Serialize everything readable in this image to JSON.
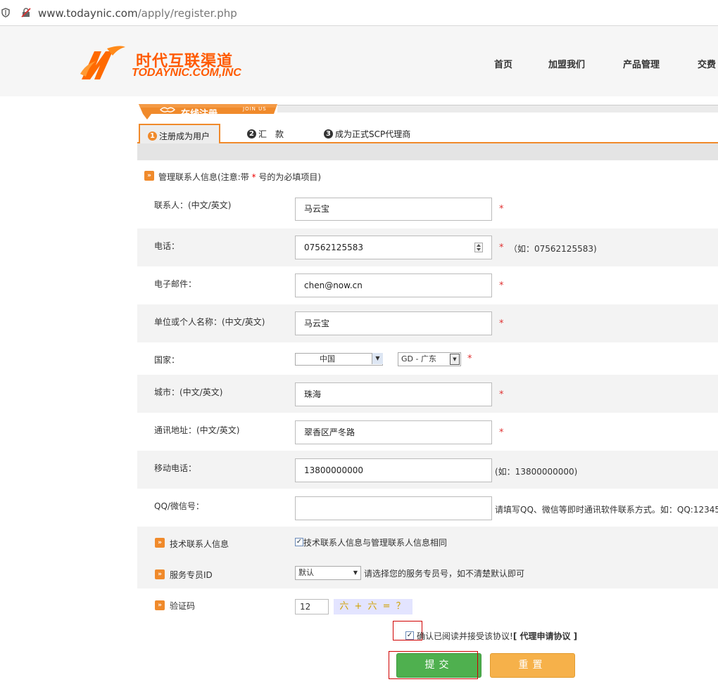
{
  "address_bar": {
    "url_main": "www.todaynic.com",
    "url_path": "/apply/register.php"
  },
  "header": {
    "logo_cn": "时代互联渠道",
    "logo_en": "TODAYNIC.COM,INC",
    "nav": [
      "首页",
      "加盟我们",
      "产品管理",
      "交费"
    ]
  },
  "title_tab": {
    "label": "在线注册",
    "sub": "JOIN US"
  },
  "steps": [
    {
      "num": "1",
      "label": "注册成为用户"
    },
    {
      "num": "2",
      "label": "汇　款"
    },
    {
      "num": "3",
      "label": "成为正式SCP代理商"
    }
  ],
  "section": {
    "text_before": "管理联系人信息(注意:带",
    "star": "*",
    "text_after": "号的为必填项目)"
  },
  "fields": {
    "contact": {
      "label": "联系人：(中文/英文)",
      "value": "马云宝",
      "star": "*"
    },
    "phone": {
      "label": "电话：",
      "value": "07562125583",
      "star": "*",
      "hint": "（如：07562125583)"
    },
    "email": {
      "label": "电子邮件：",
      "value": "chen@now.cn",
      "star": "*"
    },
    "org": {
      "label": "单位或个人名称：(中文/英文)",
      "value": "马云宝",
      "star": "*"
    },
    "country": {
      "label": "国家：",
      "country_value": "中国",
      "province_value": "GD - 广东",
      "star": "*"
    },
    "city": {
      "label": "城市：(中文/英文)",
      "value": "珠海",
      "star": "*"
    },
    "address": {
      "label": "通讯地址：(中文/英文)",
      "value": "翠香区严冬路",
      "star": "*"
    },
    "mobile": {
      "label": "移动电话：",
      "value": "13800000000",
      "hint": "(如：13800000000)"
    },
    "qq": {
      "label": "QQ/微信号：",
      "value": "",
      "hint": "请填写QQ、微信等即时通讯软件联系方式。如：QQ:12345"
    }
  },
  "tech_contact": {
    "label": "技术联系人信息",
    "checkbox_label": "技术联系人信息与管理联系人信息相同",
    "checked": true
  },
  "service_id": {
    "label": "服务专员ID",
    "value": "默认",
    "hint": "请选择您的服务专员号，如不清楚默认即可"
  },
  "captcha": {
    "label": "验证码",
    "value": "12",
    "image_text": "六 + 六 = ？"
  },
  "agreement": {
    "text": "确认已阅读并接受该协议!",
    "link": "[ 代理申请协议 ]",
    "checked": true
  },
  "buttons": {
    "submit": "提交",
    "reset": "重置"
  },
  "colors": {
    "accent": "#f08a2b",
    "submit": "#4fb04f",
    "reset": "#f6b14a",
    "required": "#e03030"
  }
}
